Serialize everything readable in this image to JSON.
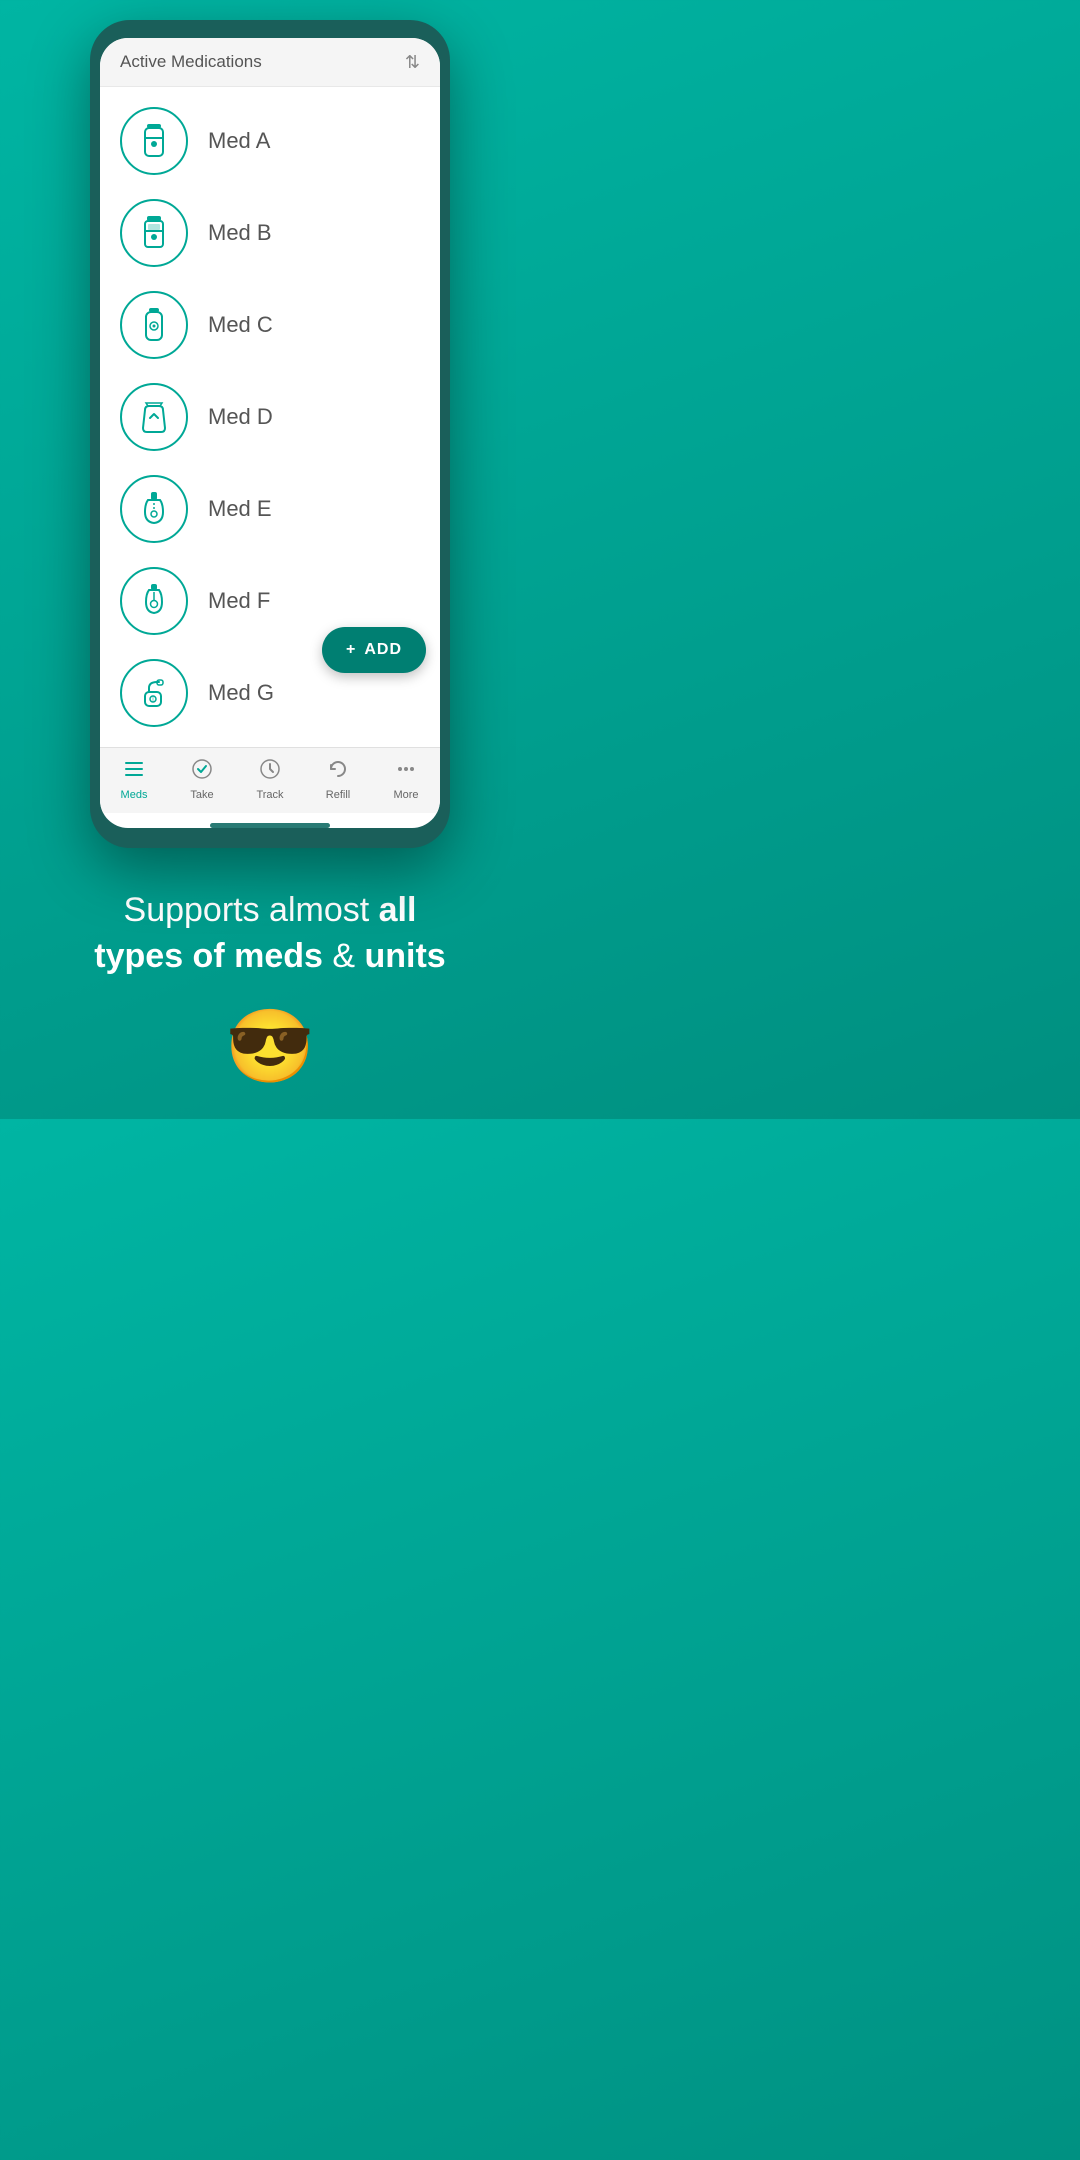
{
  "header": {
    "title": "Active Medications",
    "sort_icon": "⇅"
  },
  "medications": [
    {
      "id": "med-a",
      "name": "Med A",
      "icon_type": "pill_bottle"
    },
    {
      "id": "med-b",
      "name": "Med B",
      "icon_type": "pill_bottle2"
    },
    {
      "id": "med-c",
      "name": "Med C",
      "icon_type": "bottle_small"
    },
    {
      "id": "med-d",
      "name": "Med D",
      "icon_type": "pouch"
    },
    {
      "id": "med-e",
      "name": "Med E",
      "icon_type": "dropper"
    },
    {
      "id": "med-f",
      "name": "Med F",
      "icon_type": "dropper2"
    },
    {
      "id": "med-g",
      "name": "Med G",
      "icon_type": "inhaler"
    }
  ],
  "add_button": {
    "label": "ADD",
    "plus": "+"
  },
  "bottom_tabs": [
    {
      "id": "meds",
      "label": "Meds",
      "icon": "meds-icon",
      "active": true
    },
    {
      "id": "take",
      "label": "Take",
      "icon": "take-icon",
      "active": false
    },
    {
      "id": "track",
      "label": "Track",
      "icon": "track-icon",
      "active": false
    },
    {
      "id": "refill",
      "label": "Refill",
      "icon": "refill-icon",
      "active": false
    },
    {
      "id": "more",
      "label": "More",
      "icon": "more-icon",
      "active": false
    }
  ],
  "promo": {
    "line1": "Supports almost ",
    "bold1": "all",
    "line2": "types of meds",
    "normal2": " & ",
    "bold2": "units",
    "emoji": "😎"
  }
}
